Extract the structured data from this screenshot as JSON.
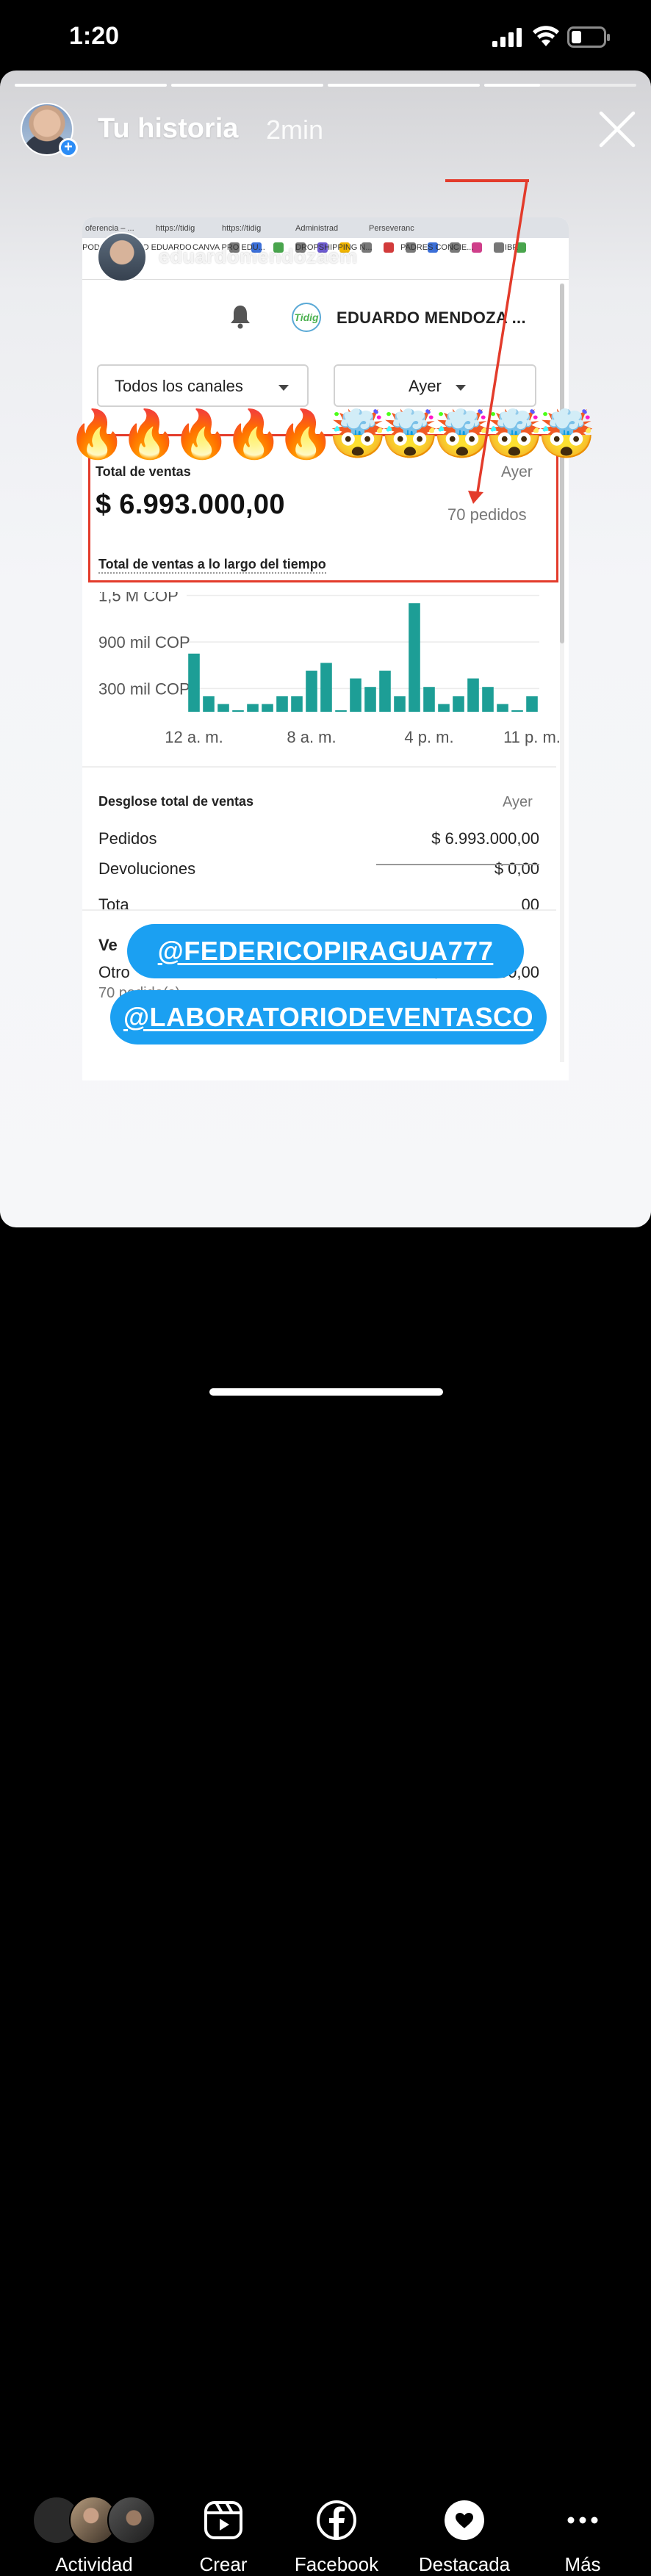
{
  "status_bar": {
    "time": "1:20"
  },
  "story_header": {
    "title": "Tu historia",
    "time_ago": "2min"
  },
  "screenshot": {
    "browser_tabs": [
      "oferencia – ...",
      "https://tidig",
      "https://tidig",
      "Administrad",
      "Perseveranc"
    ],
    "bookmarks": [
      "POD",
      "O EDUARDO",
      "CANVA PRO EDU...",
      "DROPSHIPPING N...",
      "PADRES CONCIE...",
      "IBR"
    ],
    "overlay_handle": "eduardomendozaem",
    "store_logo": "Tidig",
    "store_name": "EDUARDO MENDOZA ...",
    "filter_channels": "Todos los canales",
    "filter_date": "Ayer",
    "sales_card": {
      "title": "Total de ventas",
      "period": "Ayer",
      "amount": "$ 6.993.000,00",
      "orders": "70 pedidos",
      "subtitle": "Total de ventas a lo largo del tiempo"
    },
    "breakdown": {
      "title": "Desglose total de ventas",
      "period": "Ayer",
      "rows": [
        {
          "label": "Pedidos",
          "value": "$ 6.993.000,00"
        },
        {
          "label": "Devoluciones",
          "value": "$ 0,00"
        },
        {
          "label": "Tota",
          "value": "00"
        }
      ],
      "channel_header": "Ve",
      "channel_label": "Otro",
      "channel_value": "$ 6.993.000,00",
      "channel_orders": "70 pedido(s)"
    }
  },
  "chart_data": {
    "type": "bar",
    "series_color": "#1d9e96",
    "y_tick_labels": [
      "1,5 M COP",
      "900 mil COP",
      "300 mil COP"
    ],
    "x_tick_labels": [
      "12 a. m.",
      "8 a. m.",
      "4 p. m.",
      "11 p. m."
    ],
    "categories": [
      "0",
      "1",
      "2",
      "3",
      "4",
      "5",
      "6",
      "7",
      "8",
      "9",
      "10",
      "11",
      "12",
      "13",
      "14",
      "15",
      "16",
      "17",
      "18",
      "19",
      "20",
      "21",
      "22",
      "23"
    ],
    "values": [
      750000,
      200000,
      100000,
      20000,
      100000,
      100000,
      200000,
      200000,
      530000,
      630000,
      20000,
      430000,
      320000,
      530000,
      200000,
      1400000,
      320000,
      100000,
      200000,
      430000,
      320000,
      100000,
      20000,
      200000
    ],
    "unit": "COP",
    "ylim": [
      0,
      1500000
    ],
    "grid": true
  },
  "stickers": {
    "fire": "🔥",
    "mindblown": "🤯",
    "fire_count": 5,
    "mindblown_count": 5
  },
  "mentions": [
    "@FEDERICOPIRAGUA777",
    "@LABORATORIODEVENTASCO"
  ],
  "bottom_nav": {
    "items": [
      {
        "label": "Actividad",
        "icon": "avatars-icon"
      },
      {
        "label": "Crear",
        "icon": "reels-icon"
      },
      {
        "label": "Facebook",
        "icon": "facebook-icon"
      },
      {
        "label": "Destacada",
        "icon": "heart-icon"
      },
      {
        "label": "Más",
        "icon": "more-icon"
      }
    ]
  }
}
